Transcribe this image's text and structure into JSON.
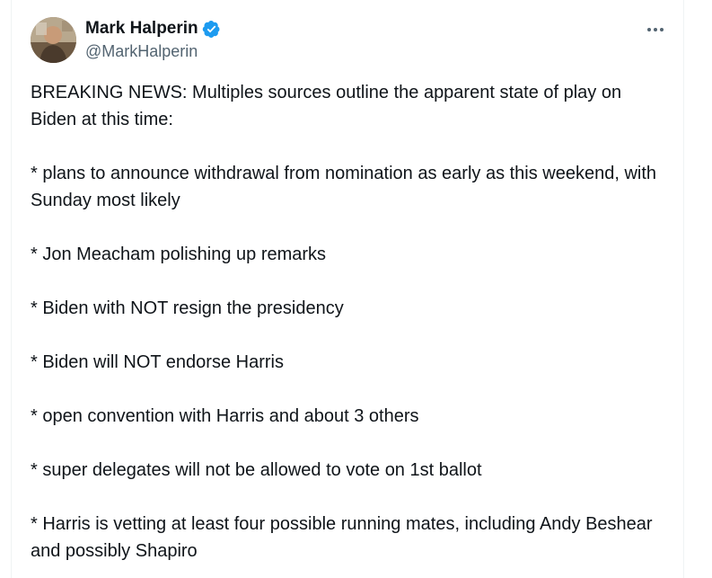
{
  "author": {
    "display_name": "Mark Halperin",
    "handle": "@MarkHalperin",
    "verified": true,
    "avatar_icon": "profile-photo",
    "verified_icon": "verified-badge-icon",
    "verified_color": "#1d9bf0"
  },
  "menu": {
    "icon": "more-options-icon"
  },
  "tweet": {
    "paragraphs": [
      "BREAKING NEWS: Multiples sources outline the apparent state of play on Biden at this time:",
      "* plans to announce withdrawal from nomination as early as this weekend, with Sunday most likely",
      "* Jon Meacham polishing up remarks",
      "* Biden with NOT resign the presidency",
      "* Biden will NOT endorse Harris",
      "* open convention with Harris and about 3 others",
      "* super delegates will not be allowed to vote on 1st ballot",
      "* Harris is vetting at least four possible running mates, including Andy Beshear and possibly Shapiro"
    ]
  },
  "colors": {
    "text": "#0f1419",
    "secondary_text": "#536471",
    "border": "#eff3f4"
  }
}
